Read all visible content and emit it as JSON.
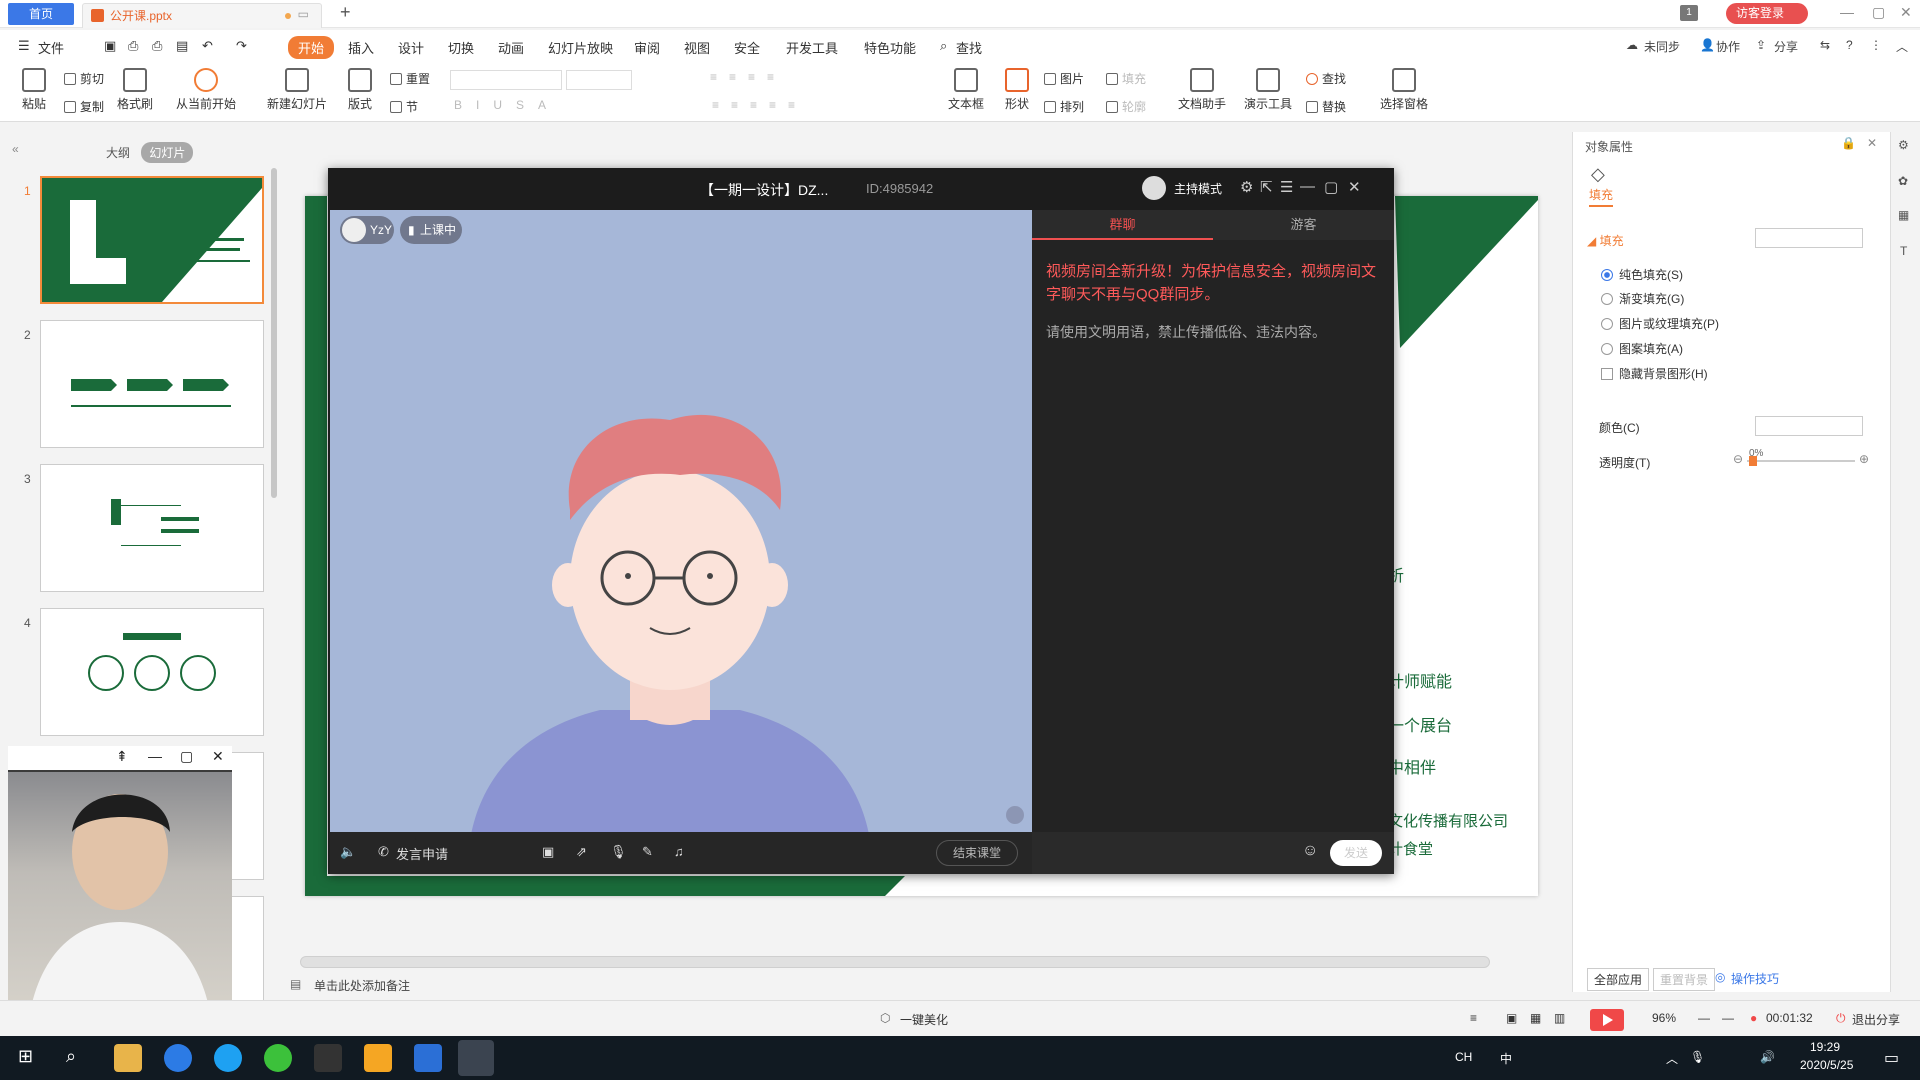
{
  "titlebar": {
    "home_tab": "首页",
    "file_tab": "公开课.pptx",
    "new_tab": "+",
    "badge": "1",
    "visitor_login": "访客登录"
  },
  "menubar": {
    "file": "文件",
    "items": [
      "开始",
      "插入",
      "设计",
      "切换",
      "动画",
      "幻灯片放映",
      "审阅",
      "视图",
      "安全",
      "开发工具",
      "特色功能",
      "查找"
    ],
    "right": [
      "未同步",
      "协作",
      "分享"
    ]
  },
  "ribbon": {
    "paste": "粘贴",
    "cut": "剪切",
    "copy": "复制",
    "format_painter": "格式刷",
    "from_current": "从当前开始",
    "new_slide": "新建幻灯片",
    "layout": "版式",
    "reset": "重置",
    "section": "节",
    "text_box": "文本框",
    "shape": "形状",
    "picture": "图片",
    "fill": "填充",
    "arrange": "排列",
    "outline": "轮廓",
    "doc_helper": "文档助手",
    "present_tools": "演示工具",
    "find": "查找",
    "replace": "替换",
    "select_pane": "选择窗格"
  },
  "leftpanel": {
    "tab_outline": "大纲",
    "tab_slides": "幻灯片",
    "slide_numbers": [
      "1",
      "2",
      "3",
      "4"
    ]
  },
  "slide": {
    "lines": [
      "析",
      "计师赋能",
      "一个展台",
      "中相伴",
      "文化传播有限公司",
      "计食堂"
    ]
  },
  "livewin": {
    "title": "【一期一设计】DZ...",
    "room_id": "ID:4985942",
    "host_mode": "主持模式",
    "user_name": "YzY",
    "class_status": "上课中",
    "request_speak": "发言申请",
    "end_class": "结束课堂",
    "chat_tab_group": "群聊",
    "chat_tab_guest": "游客",
    "notice_red": "视频房间全新升级！为保护信息安全，视频房间文字聊天不再与QQ群同步。",
    "notice_gray": "请使用文明用语，禁止传播低俗、违法内容。",
    "send": "发送"
  },
  "rightpanel": {
    "title": "对象属性",
    "tab_fill": "填充",
    "section_fill": "填充",
    "options": [
      "纯色填充(S)",
      "渐变填充(G)",
      "图片或纹理填充(P)",
      "图案填充(A)"
    ],
    "hide_bg": "隐藏背景图形(H)",
    "color_label": "颜色(C)",
    "transparency_label": "透明度(T)",
    "transparency_value": "0%",
    "apply_all": "全部应用",
    "reset_bg": "重置背景",
    "tips": "操作技巧"
  },
  "notes": {
    "placeholder": "单击此处添加备注"
  },
  "statusbar": {
    "beautify": "一键美化",
    "zoom": "96%",
    "timer": "00:01:32",
    "exit_show": "退出分享"
  },
  "taskbar": {
    "time": "19:29",
    "date": "2020/5/25",
    "ime": "中"
  },
  "colors": {
    "wps_orange": "#f17c35",
    "brand_green": "#1a6b3a",
    "chat_red": "#ff5a5a",
    "accent_blue": "#3b78e7"
  }
}
